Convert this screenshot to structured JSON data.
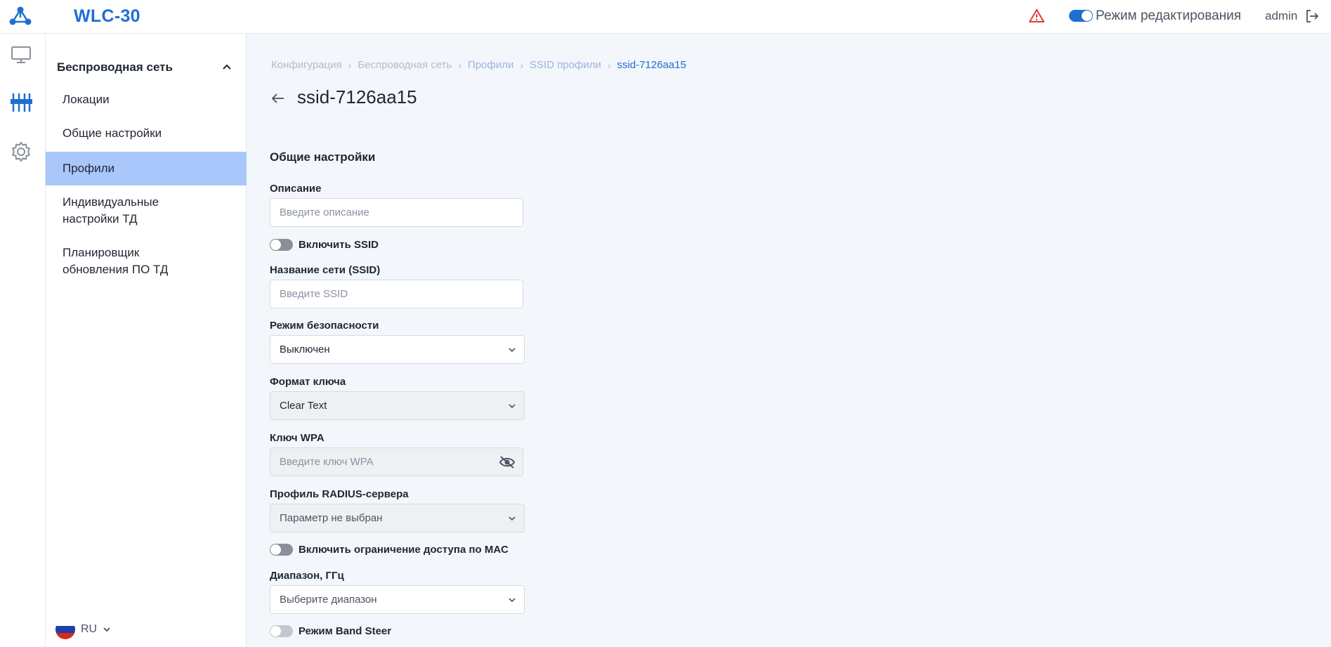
{
  "app": {
    "title": "WLC-30",
    "logo_icon": "network-logo-icon"
  },
  "header": {
    "edit_mode_label": "Режим редактирования",
    "edit_mode_on": true,
    "user": "admin",
    "accent": "#1f6fd1",
    "warning_color": "#e53935"
  },
  "rail": [
    "monitor-icon",
    "equalizer-icon",
    "gear-icon"
  ],
  "sidebar": {
    "section": "Беспроводная сеть",
    "items": [
      {
        "label": "Локации"
      },
      {
        "label": "Общие настройки"
      },
      {
        "label": "Профили",
        "active": true
      },
      {
        "label": "Индивидуальные\nнастройки ТД"
      },
      {
        "label": "Планировщик\nобновления ПО ТД"
      }
    ],
    "language": "RU"
  },
  "breadcrumbs": [
    "Конфигурация",
    "Беспроводная сеть",
    "Профили",
    "SSID профили",
    "ssid-7126aa15"
  ],
  "page": {
    "title": "ssid-7126aa15",
    "section_title": "Общие настройки"
  },
  "form": {
    "description": {
      "label": "Описание",
      "value": "",
      "placeholder": "Введите описание"
    },
    "enable_ssid": {
      "label": "Включить SSID",
      "on": false
    },
    "ssid": {
      "label": "Название сети (SSID)",
      "value": "",
      "placeholder": "Введите SSID"
    },
    "security_mode": {
      "label": "Режим безопасности",
      "value": "Выключен"
    },
    "key_format": {
      "label": "Формат ключа",
      "value": "Clear Text"
    },
    "wpa_key": {
      "label": "Ключ WPA",
      "value": "",
      "placeholder": "Введите ключ WPA"
    },
    "radius_profile": {
      "label": "Профиль RADIUS-сервера",
      "value": "Параметр не выбран"
    },
    "mac_restriction": {
      "label": "Включить ограничение доступа по MAC",
      "on": false
    },
    "band": {
      "label": "Диапазон, ГГц",
      "value": "Выберите диапазон"
    },
    "band_steer": {
      "label": "Режим Band Steer",
      "on": false
    }
  }
}
